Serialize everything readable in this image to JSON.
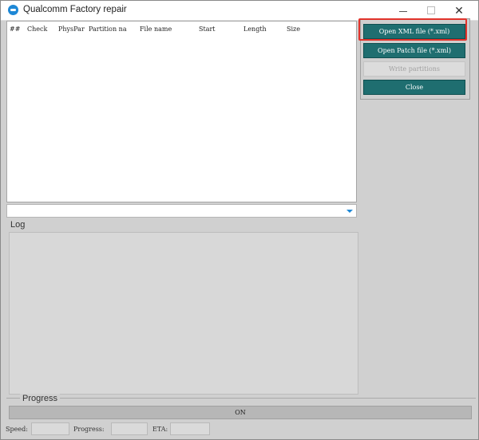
{
  "window": {
    "title": "Qualcomm Factory repair"
  },
  "grid": {
    "columns": [
      "##",
      "Check",
      "PhysPar",
      "Partition na",
      "File name",
      "Start",
      "Length",
      "Size"
    ]
  },
  "buttons": {
    "open_xml": "Open XML file (*.xml)",
    "open_patch": "Open Patch file (*.xml)",
    "write_partitions": "Write partitions",
    "close": "Close"
  },
  "log": {
    "label": "Log"
  },
  "progress": {
    "label": "Progress",
    "bar_text": "ON"
  },
  "status": {
    "speed_label": "Speed:",
    "progress_label": "Progress:",
    "eta_label": "ETA:"
  },
  "icons": {
    "app": "qualcomm-logo-icon",
    "minimize": "minimize-icon",
    "maximize": "maximize-icon",
    "close": "close-icon",
    "dropdown": "chevron-down-icon"
  },
  "colors": {
    "button_teal": "#1f6e70",
    "highlight_red": "#e2332b",
    "accent_blue": "#1e88d6"
  }
}
